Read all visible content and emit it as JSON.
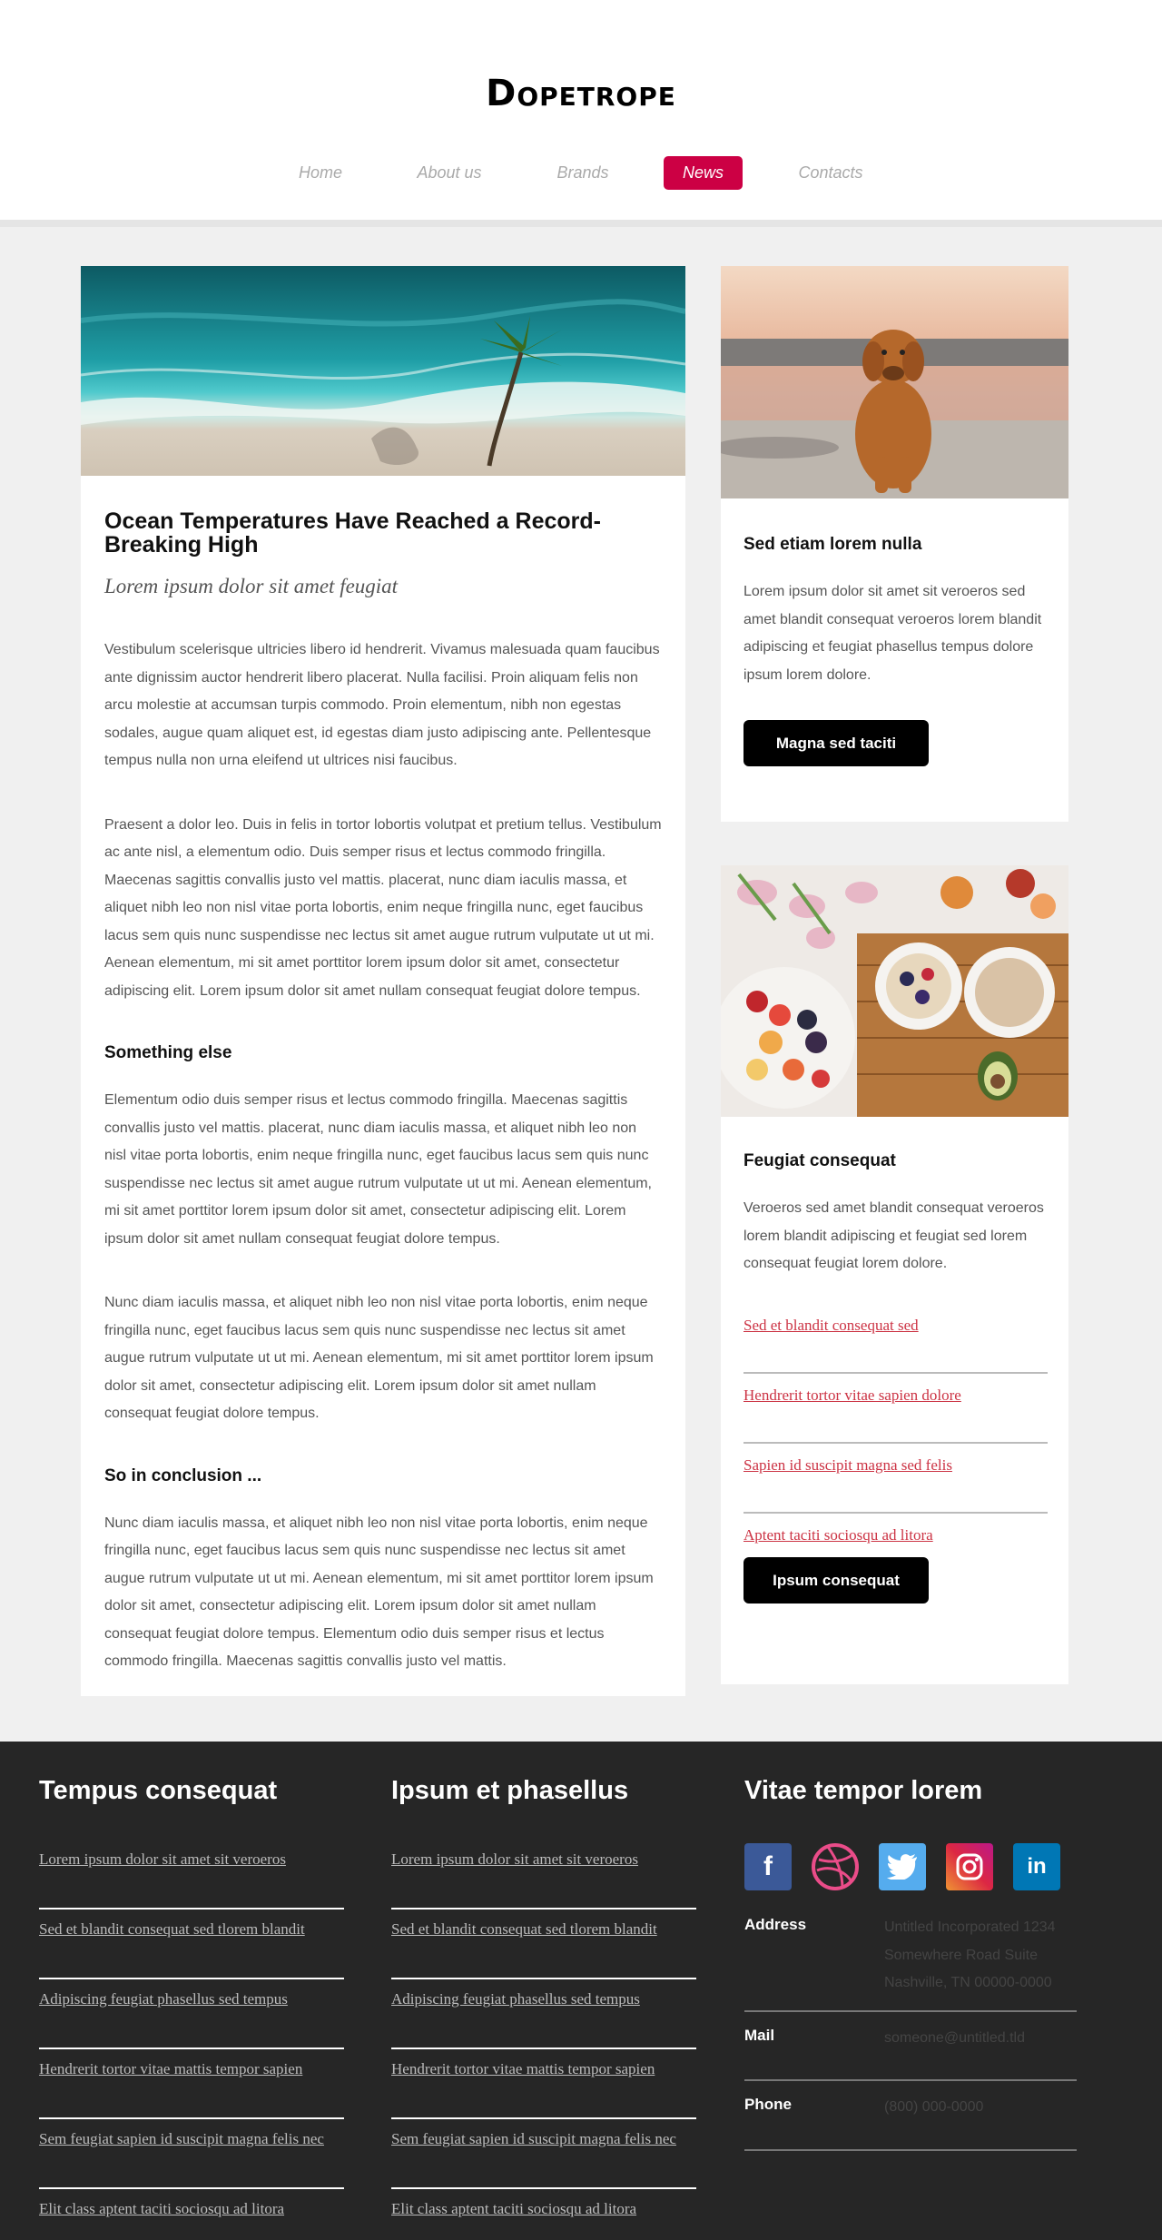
{
  "header": {
    "logo": "Dopetrope",
    "nav": [
      {
        "label": "Home",
        "active": false
      },
      {
        "label": "About us",
        "active": false
      },
      {
        "label": "Brands",
        "active": false
      },
      {
        "label": "News",
        "active": true
      },
      {
        "label": "Contacts",
        "active": false
      }
    ]
  },
  "article": {
    "title": "Ocean Temperatures Have Reached a Record-Breaking High",
    "subtitle": "Lorem ipsum dolor sit amet feugiat",
    "p1": "Vestibulum scelerisque ultricies libero id hendrerit. Vivamus malesuada quam faucibus ante dignissim auctor hendrerit libero placerat. Nulla facilisi. Proin aliquam felis non arcu molestie at accumsan turpis commodo. Proin elementum, nibh non egestas sodales, augue quam aliquet est, id egestas diam justo adipiscing ante. Pellentesque tempus nulla non urna eleifend ut ultrices nisi faucibus.",
    "p2": "Praesent a dolor leo. Duis in felis in tortor lobortis volutpat et pretium tellus. Vestibulum ac ante nisl, a elementum odio. Duis semper risus et lectus commodo fringilla. Maecenas sagittis convallis justo vel mattis. placerat, nunc diam iaculis massa, et aliquet nibh leo non nisl vitae porta lobortis, enim neque fringilla nunc, eget faucibus lacus sem quis nunc suspendisse nec lectus sit amet augue rutrum vulputate ut ut mi. Aenean elementum, mi sit amet porttitor lorem ipsum dolor sit amet, consectetur adipiscing elit. Lorem ipsum dolor sit amet nullam consequat feugiat dolore tempus.",
    "h2": "Something else",
    "p3": "Elementum odio duis semper risus et lectus commodo fringilla. Maecenas sagittis convallis justo vel mattis. placerat, nunc diam iaculis massa, et aliquet nibh leo non nisl vitae porta lobortis, enim neque fringilla nunc, eget faucibus lacus sem quis nunc suspendisse nec lectus sit amet augue rutrum vulputate ut ut mi. Aenean elementum, mi sit amet porttitor lorem ipsum dolor sit amet, consectetur adipiscing elit. Lorem ipsum dolor sit amet nullam consequat feugiat dolore tempus.",
    "p4": "Nunc diam iaculis massa, et aliquet nibh leo non nisl vitae porta lobortis, enim neque fringilla nunc, eget faucibus lacus sem quis nunc suspendisse nec lectus sit amet augue rutrum vulputate ut ut mi. Aenean elementum, mi sit amet porttitor lorem ipsum dolor sit amet, consectetur adipiscing elit. Lorem ipsum dolor sit amet nullam consequat feugiat dolore tempus.",
    "h3": "So in conclusion ...",
    "p5": "Nunc diam iaculis massa, et aliquet nibh leo non nisl vitae porta lobortis, enim neque fringilla nunc, eget faucibus lacus sem quis nunc suspendisse nec lectus sit amet augue rutrum vulputate ut ut mi. Aenean elementum, mi sit amet porttitor lorem ipsum dolor sit amet, consectetur adipiscing elit. Lorem ipsum dolor sit amet nullam consequat feugiat dolore tempus. Elementum odio duis semper risus et lectus commodo fringilla. Maecenas sagittis convallis justo vel mattis."
  },
  "side1": {
    "title": "Sed etiam lorem nulla",
    "text": "Lorem ipsum dolor sit amet sit veroeros sed amet blandit consequat veroeros lorem blandit adipiscing et feugiat phasellus tempus dolore ipsum lorem dolore.",
    "button": "Magna sed taciti"
  },
  "side2": {
    "title": "Feugiat consequat",
    "text": "Veroeros sed amet blandit consequat veroeros lorem blandit adipiscing et feugiat sed lorem consequat feugiat lorem dolore.",
    "links": [
      "Sed et blandit consequat sed",
      "Hendrerit tortor vitae sapien dolore",
      "Sapien id suscipit magna sed felis",
      "Aptent taciti sociosqu ad litora"
    ],
    "button": "Ipsum consequat"
  },
  "footer": {
    "col1": {
      "title": "Tempus consequat",
      "links": [
        "Lorem ipsum dolor sit amet sit veroeros",
        "Sed et blandit consequat sed tlorem blandit",
        "Adipiscing feugiat phasellus sed tempus",
        "Hendrerit tortor vitae mattis tempor sapien",
        "Sem feugiat sapien id suscipit magna felis nec",
        "Elit class aptent taciti sociosqu ad litora"
      ]
    },
    "col2": {
      "title": "Ipsum et phasellus",
      "links": [
        "Lorem ipsum dolor sit amet sit veroeros",
        "Sed et blandit consequat sed tlorem blandit",
        "Adipiscing feugiat phasellus sed tempus",
        "Hendrerit tortor vitae mattis tempor sapien",
        "Sem feugiat sapien id suscipit magna felis nec",
        "Elit class aptent taciti sociosqu ad litora"
      ]
    },
    "col3": {
      "title": "Vitae tempor lorem",
      "social": [
        {
          "icon": "facebook-icon",
          "glyph": "f",
          "color": "#3b5998"
        },
        {
          "icon": "dribbble-icon",
          "glyph": "",
          "color": "#ea4c89"
        },
        {
          "icon": "twitter-icon",
          "glyph": "",
          "color": "#55acee"
        },
        {
          "icon": "instagram-icon",
          "glyph": "",
          "color": "#c13584"
        },
        {
          "icon": "linkedin-icon",
          "glyph": "in",
          "color": "#0077b5"
        }
      ],
      "address_label": "Address",
      "address": "Untitled Incorporated 1234 Somewhere Road Suite Nashville, TN 00000-0000",
      "mail_label": "Mail",
      "mail": "someone@untitled.tld",
      "phone_label": "Phone",
      "phone": "(800) 000-0000"
    }
  },
  "colors": {
    "accent": "#cc0044",
    "footer_bg": "#262626",
    "link_red": "#cc3344"
  }
}
